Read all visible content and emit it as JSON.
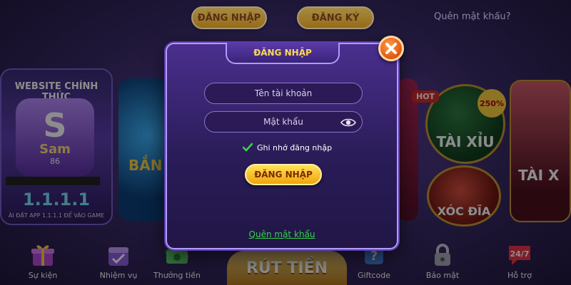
{
  "top_bar": {
    "login_label": "ĐĂNG NHẬP",
    "register_label": "ĐĂNG KÝ",
    "forgot_password": "Quên mật khẩu?"
  },
  "background": {
    "website_card": {
      "title": "WEBSITE CHÍNH THỨC",
      "logo_letter": "S",
      "logo_name": "Sam",
      "logo_number": "86",
      "version": "1.1.1.1",
      "hint": "ÀI ĐẶT APP 1.1.1.1 ĐỂ VÀO GAME"
    },
    "fish_card_label": "BẮN",
    "taixiu_circle": {
      "label": "TÀI XỈU",
      "hot_badge": "HOT",
      "percent_badge": "250%"
    },
    "xocdia_circle_label": "XÓC ĐĨA",
    "taixiu_card_label": "TÀI X"
  },
  "bottom_nav": {
    "events": "Sự kiện",
    "missions": "Nhiệm vụ",
    "rewards": "Thưởng tiền",
    "withdraw": "RÚT TIỀN",
    "giftcode": "Giftcode",
    "security": "Bảo mật",
    "support": "Hỗ trợ",
    "support_badge": "24/7"
  },
  "modal": {
    "title": "ĐĂNG NHẬP",
    "username_placeholder": "Tên tài khoản",
    "password_placeholder": "Mật khẩu",
    "remember_label": "Ghi nhớ đăng nhập",
    "remember_checked": true,
    "login_button": "ĐĂNG NHẬP",
    "forgot_link": "Quên mật khẩu",
    "close_icon": "close-icon",
    "eye_icon": "eye-icon"
  },
  "colors": {
    "accent_gold": "#ffd857",
    "link_green": "#34d04a",
    "close_orange": "#e2570c"
  }
}
